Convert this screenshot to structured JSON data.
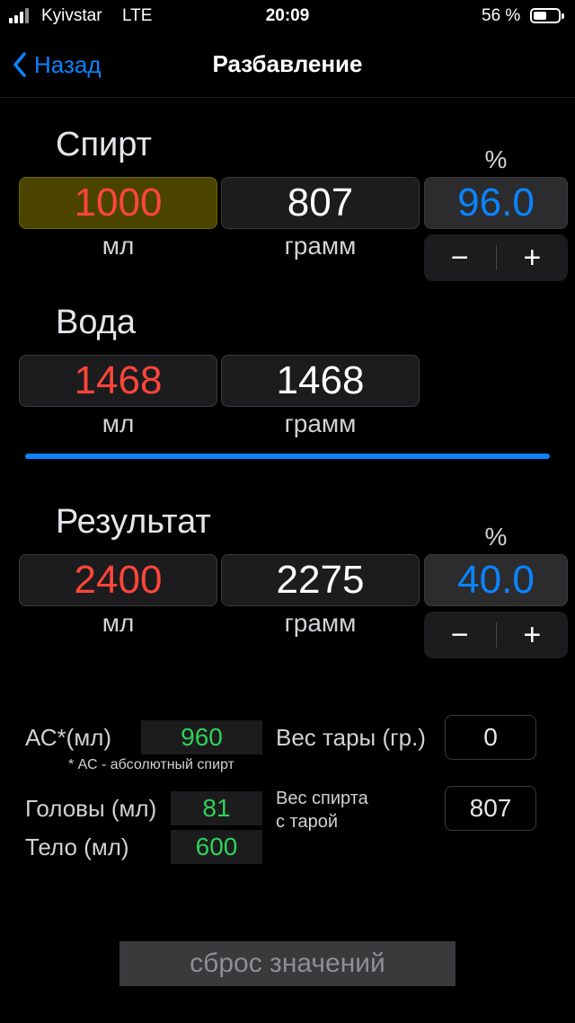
{
  "status_bar": {
    "carrier": "Kyivstar",
    "network": "LTE",
    "time": "20:09",
    "battery": "56 %"
  },
  "nav": {
    "back_label": "Назад",
    "title": "Разбавление"
  },
  "spirit": {
    "title": "Спирт",
    "ml_value": "1000",
    "gram_value": "807",
    "percent_label": "%",
    "percent_value": "96.0",
    "ml_unit": "мл",
    "gram_unit": "грамм"
  },
  "water": {
    "title": "Вода",
    "ml_value": "1468",
    "gram_value": "1468",
    "ml_unit": "мл",
    "gram_unit": "грамм"
  },
  "result": {
    "title": "Результат",
    "ml_value": "2400",
    "gram_value": "2275",
    "percent_label": "%",
    "percent_value": "40.0",
    "ml_unit": "мл",
    "gram_unit": "грамм"
  },
  "stepper": {
    "minus": "−",
    "plus": "+"
  },
  "info": {
    "ac_label": "АС*(мл)",
    "ac_value": "960",
    "ac_note": "* АС - абсолютный спирт",
    "tare_label": "Вес тары (гр.)",
    "tare_value": "0",
    "heads_label": "Головы (мл)",
    "heads_value": "81",
    "body_label": "Тело (мл)",
    "body_value": "600",
    "spirit_tare_label_1": "Вес спирта",
    "spirit_tare_label_2": "с тарой",
    "spirit_tare_value": "807"
  },
  "reset_label": "сброс значений",
  "colors": {
    "accent": "#0a84ff",
    "red": "#ff453a",
    "green": "#30d158",
    "highlight": "#4a4400"
  }
}
